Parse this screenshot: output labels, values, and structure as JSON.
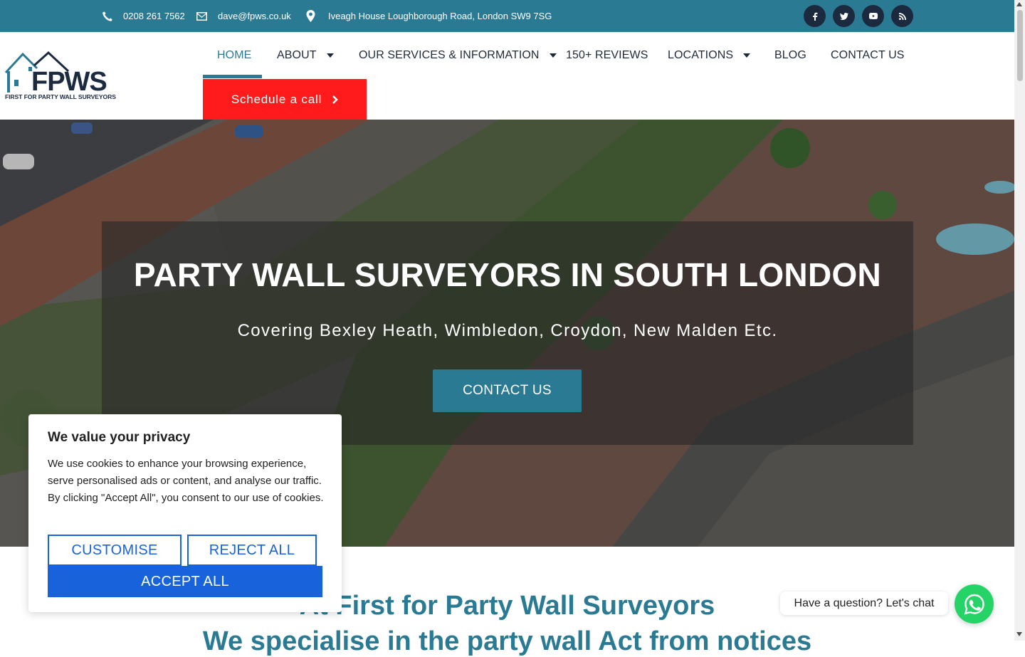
{
  "topbar": {
    "phone": "0208 261 7562",
    "email": "dave@fpws.co.uk",
    "address": "Iveagh House Loughborough Road, London SW9 7SG",
    "social_icons": [
      "facebook-icon",
      "twitter-icon",
      "youtube-icon",
      "rss-icon"
    ]
  },
  "logo": {
    "text": "FPWS",
    "tagline": "FIRST FOR PARTY WALL SURVEYORS"
  },
  "nav": {
    "items": [
      {
        "label": "HOME",
        "active": true,
        "dropdown": false
      },
      {
        "label": "ABOUT",
        "active": false,
        "dropdown": true
      },
      {
        "label": "OUR SERVICES & INFORMATION",
        "active": false,
        "dropdown": true
      },
      {
        "label": "150+ REVIEWS",
        "active": false,
        "dropdown": false
      },
      {
        "label": "LOCATIONS",
        "active": false,
        "dropdown": true
      },
      {
        "label": "BLOG",
        "active": false,
        "dropdown": false
      },
      {
        "label": "CONTACT US",
        "active": false,
        "dropdown": false
      }
    ],
    "cta": "Schedule a call"
  },
  "hero": {
    "title": "PARTY WALL SURVEYORS IN SOUTH LONDON",
    "subtitle": "Covering Bexley Heath, Wimbledon, Croydon, New Malden Etc.",
    "button": "CONTACT US"
  },
  "about": {
    "heading": "At First for Party Wall Surveyors",
    "subheading": "We specialise in the party wall Act from notices"
  },
  "cookie": {
    "title": "We value your privacy",
    "text": "We use cookies to enhance your browsing experience, serve personalised ads or content, and analyse our traffic. By clicking \"Accept All\", you consent to our use of cookies.",
    "customise": "CUSTOMISE",
    "reject": "REJECT ALL",
    "accept": "ACCEPT ALL"
  },
  "chat": {
    "prompt": "Have a question? Let's chat"
  },
  "colors": {
    "brand_teal": "#2a7a93",
    "cta_red": "#ff1b1b",
    "cookie_blue": "#1863dc",
    "whatsapp_green": "#25d366"
  }
}
